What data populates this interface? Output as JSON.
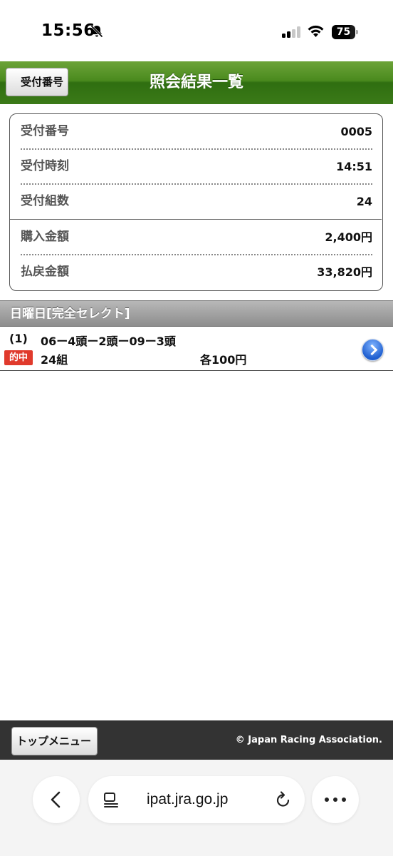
{
  "status_bar": {
    "time": "15:56",
    "battery": "75"
  },
  "header": {
    "back_label": "受付番号",
    "title": "照会結果一覧"
  },
  "summary": {
    "rows": [
      {
        "label": "受付番号",
        "value": "0005"
      },
      {
        "label": "受付時刻",
        "value": "14:51"
      },
      {
        "label": "受付組数",
        "value": "24"
      },
      {
        "label": "購入金額",
        "value": "2,400円"
      },
      {
        "label": "払戻金額",
        "value": "33,820円"
      }
    ]
  },
  "section": {
    "title": "日曜日[完全セレクト]"
  },
  "bet": {
    "index": "(1)",
    "combo": "06ー4頭ー2頭ー09ー3頭",
    "badge": "的中",
    "count": "24組",
    "each": "各100円"
  },
  "footer": {
    "top_menu_label": "トップメニュー",
    "copyright": "© Japan Racing Association."
  },
  "browser": {
    "url": "ipat.jra.go.jp"
  },
  "colors": {
    "header_green": "#3b7a18",
    "hit_red": "#e03a2c",
    "footer_dark": "#333333",
    "arrow_blue": "#1f5fd0"
  }
}
